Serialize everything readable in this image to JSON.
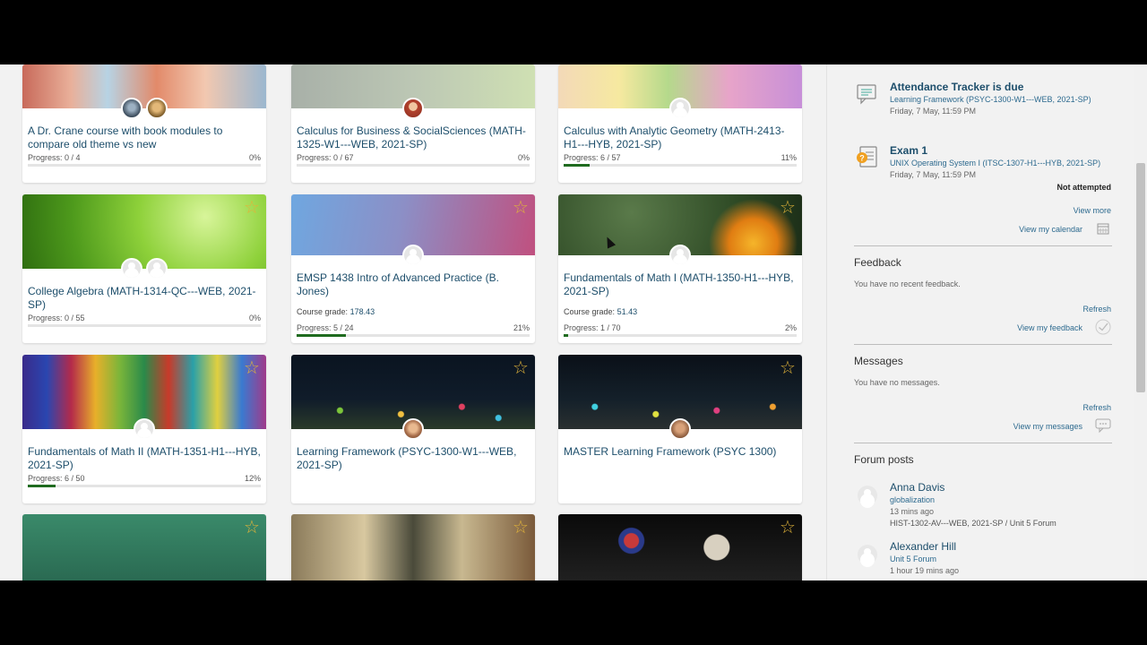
{
  "courses": [
    {
      "title": "A Dr. Crane course with book modules to compare old theme vs new",
      "progress_label": "Progress: 0 / 4",
      "percent_label": "0%",
      "progress": 0
    },
    {
      "title": "Calculus for Business & SocialSciences (MATH-1325-W1---WEB, 2021-SP)",
      "progress_label": "Progress: 0 / 67",
      "percent_label": "0%",
      "progress": 0
    },
    {
      "title": "Calculus with Analytic Geometry (MATH-2413-H1---HYB, 2021-SP)",
      "progress_label": "Progress: 6 / 57",
      "percent_label": "11%",
      "progress": 0.11
    },
    {
      "title": "College Algebra (MATH-1314-QC---WEB, 2021-SP)",
      "progress_label": "Progress: 0 / 55",
      "percent_label": "0%",
      "progress": 0
    },
    {
      "title": "EMSP 1438 Intro of Advanced Practice (B. Jones)",
      "grade_label": "Course grade:",
      "grade_value": "178.43",
      "progress_label": "Progress: 5 / 24",
      "percent_label": "21%",
      "progress": 0.21
    },
    {
      "title": "Fundamentals of Math I (MATH-1350-H1---HYB, 2021-SP)",
      "grade_label": "Course grade:",
      "grade_value": "51.43",
      "progress_label": "Progress: 1 / 70",
      "percent_label": "2%",
      "progress": 0.02
    },
    {
      "title": "Fundamentals of Math II (MATH-1351-H1---HYB, 2021-SP)",
      "progress_label": "Progress: 6 / 50",
      "percent_label": "12%",
      "progress": 0.12
    },
    {
      "title": "Learning Framework (PSYC-1300-W1---WEB, 2021-SP)"
    },
    {
      "title": "MASTER Learning Framework (PSYC 1300)"
    }
  ],
  "events": [
    {
      "title": "Attendance Tracker is due",
      "course": "Learning Framework (PSYC-1300-W1---WEB, 2021-SP)",
      "date": "Friday, 7 May, 11:59 PM"
    },
    {
      "title": "Exam 1",
      "course": "UNIX Operating System I (ITSC-1307-H1---HYB, 2021-SP)",
      "date": "Friday, 7 May, 11:59 PM",
      "status": "Not attempted"
    }
  ],
  "timeline": {
    "view_more": "View more",
    "view_calendar": "View my calendar"
  },
  "feedback": {
    "heading": "Feedback",
    "empty": "You have no recent feedback.",
    "refresh": "Refresh",
    "view": "View my feedback"
  },
  "messages": {
    "heading": "Messages",
    "empty": "You have no messages.",
    "refresh": "Refresh",
    "view": "View my messages"
  },
  "forum": {
    "heading": "Forum posts",
    "posts": [
      {
        "name": "Anna Davis",
        "subject": "globalization",
        "time": "13 mins ago",
        "path": "HIST-1302-AV---WEB, 2021-SP / Unit 5 Forum"
      },
      {
        "name": "Alexander Hill",
        "subject": "Unit 5 Forum",
        "time": "1 hour 19 mins ago"
      }
    ]
  },
  "icons": {
    "star": "☆",
    "calendar": "calendar-icon",
    "check": "check-icon",
    "chat": "chat-icon"
  },
  "colors": {
    "link": "#1d4e6b",
    "star": "#e0b33a",
    "progress": "#1f6b1f"
  }
}
